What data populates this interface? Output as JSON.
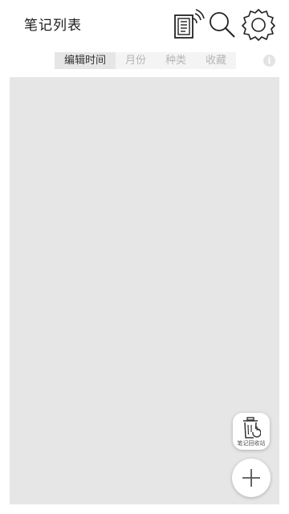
{
  "header": {
    "title": "笔记列表",
    "icons": [
      "nfc-notes-icon",
      "search-icon",
      "settings-gear-icon"
    ]
  },
  "tabs": [
    {
      "label": "编辑时间",
      "active": true
    },
    {
      "label": "月份",
      "active": false
    },
    {
      "label": "种类",
      "active": false
    },
    {
      "label": "收藏",
      "active": false
    }
  ],
  "info": {
    "glyph": "i"
  },
  "fab": {
    "recycle_label": "笔记回收站",
    "add_icon": "plus-icon"
  },
  "colors": {
    "list_background": "#e6e6e6",
    "tab_active_bg": "#e6e6e6",
    "tab_inactive_text": "#b5b5b5"
  }
}
